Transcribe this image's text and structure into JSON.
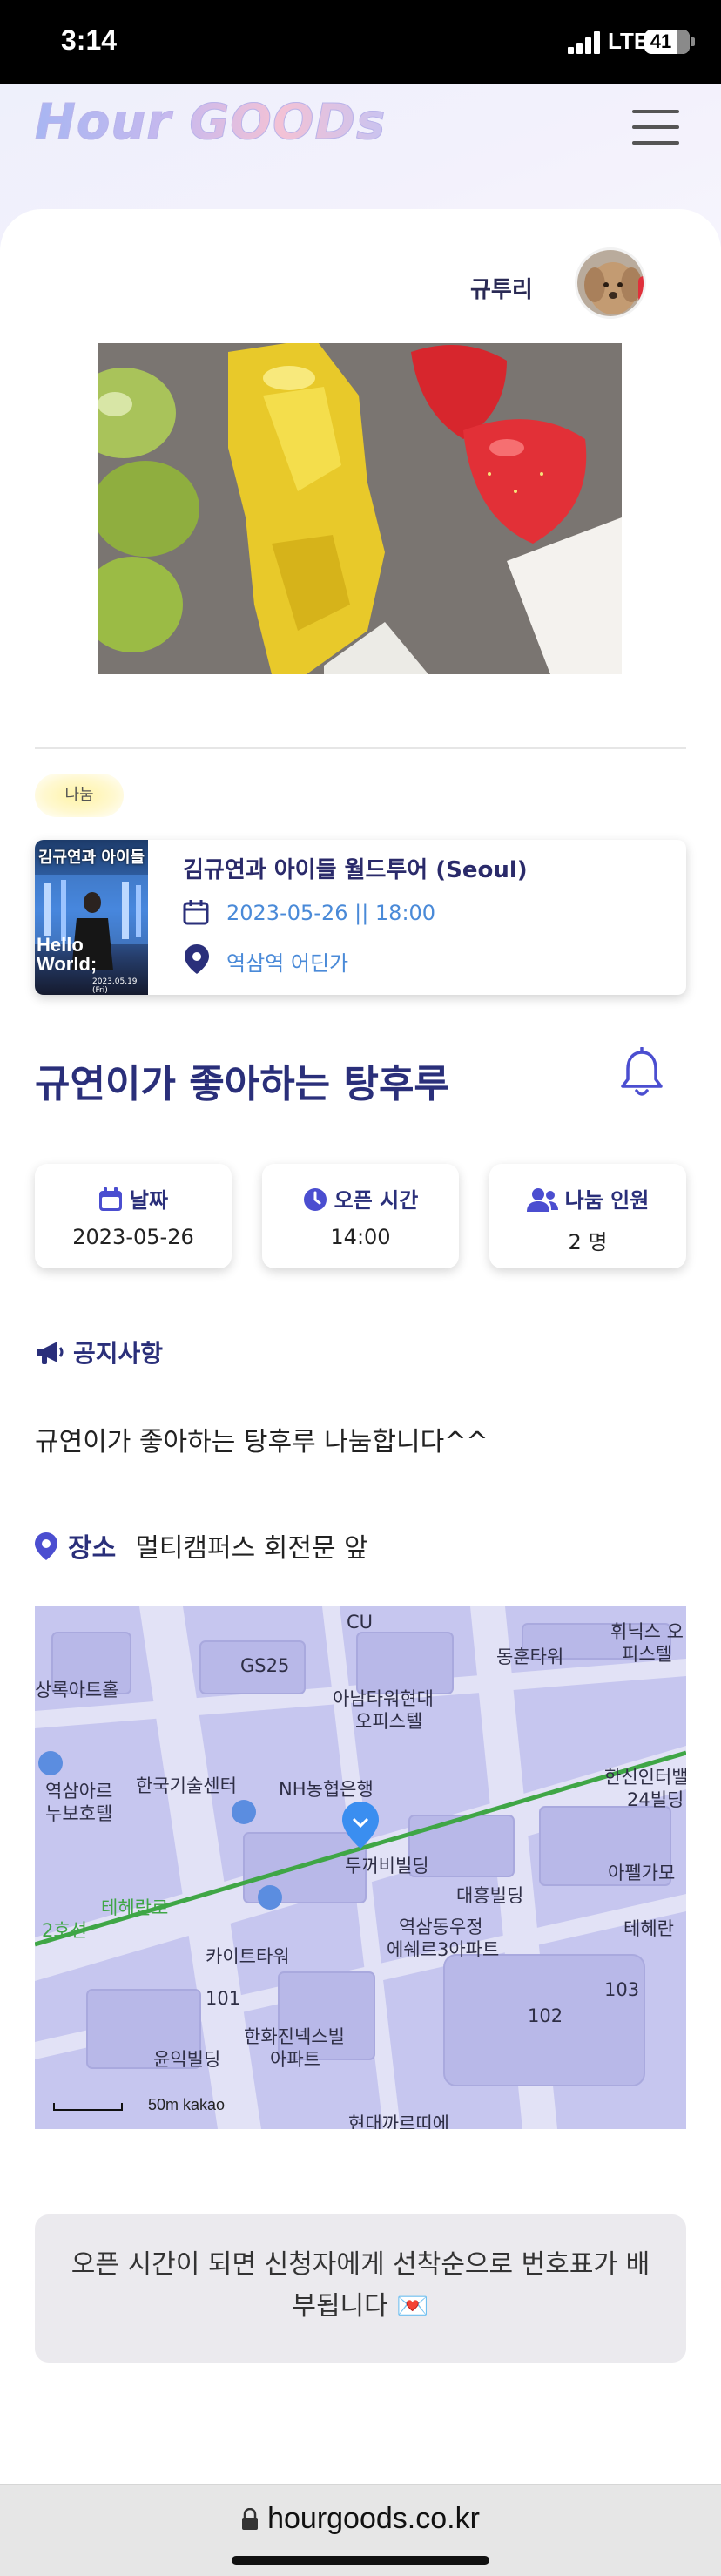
{
  "status_bar": {
    "time": "3:14",
    "network": "LTE",
    "battery": "41"
  },
  "header": {
    "logo": "Hour GOODs",
    "menu_icon": "hamburger-menu-icon"
  },
  "author": {
    "name": "규투리"
  },
  "tag": {
    "label": "나눔"
  },
  "event": {
    "thumb_top": "김규연과 아이들",
    "thumb_hello": "Hello World;",
    "thumb_date": "2023.05.19 (Fri)",
    "title": "김규연과 아이들 월드투어 (Seoul)",
    "datetime": "2023-05-26 || 18:00",
    "place": "역삼역 어딘가"
  },
  "post": {
    "title": "규연이가 좋아하는 탕후루"
  },
  "info": {
    "date_label": "날짜",
    "date_value": "2023-05-26",
    "time_label": "오픈 시간",
    "time_value": "14:00",
    "people_label": "나눔 인원",
    "people_value": "2 명"
  },
  "notice": {
    "heading": "공지사항",
    "body": "규연이가 좋아하는 탕후루 나눔합니다^^"
  },
  "place": {
    "label": "장소",
    "value": "멀티캠퍼스 회전문 앞"
  },
  "map": {
    "labels": [
      "CU",
      "GS25",
      "상록아트홀",
      "동훈타워",
      "휘닉스 오피스텔",
      "아남타워현대",
      "오피스텔",
      "역삼아르",
      "누보호텔",
      "한국기술센터",
      "NH농협은행",
      "한신인터밸",
      "24빌딩",
      "두꺼비빌딩",
      "아펠가모",
      "2호선",
      "테헤란로",
      "대흥빌딩",
      "역삼동우정",
      "에쉐르3아파트",
      "테헤란",
      "카이트타워",
      "101",
      "102",
      "103",
      "한화진넥스빌",
      "아파트",
      "윤익빌딩",
      "현대까르띠에"
    ],
    "scale": "50m",
    "provider": "kakao"
  },
  "bottom_notice": "오픈 시간이 되면 신청자에게 선착순으로 번호표가 배부됩니다 💌",
  "browser": {
    "url": "hourgoods.co.kr"
  }
}
